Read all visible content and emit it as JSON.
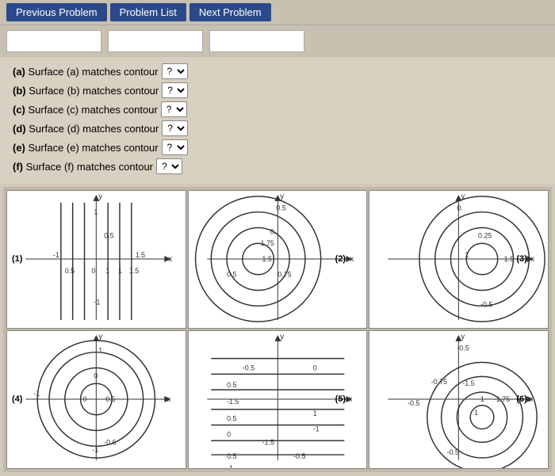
{
  "nav": {
    "prev_label": "Previous Problem",
    "list_label": "Problem List",
    "next_label": "Next Problem"
  },
  "questions": [
    {
      "label": "(a) Surface (a) matches contour",
      "id": "a"
    },
    {
      "label": "(b) Surface (b) matches contour",
      "id": "b"
    },
    {
      "label": "(c) Surface (c) matches contour",
      "id": "c"
    },
    {
      "label": "(d) Surface (d) matches contour",
      "id": "d"
    },
    {
      "label": "(e) Surface (e) matches contour",
      "id": "e"
    },
    {
      "label": "(f) Surface (f) matches contour",
      "id": "f"
    }
  ],
  "graphs": [
    {
      "id": "1",
      "label": "(1)"
    },
    {
      "id": "2",
      "label": "(2)"
    },
    {
      "id": "3",
      "label": "(3)"
    },
    {
      "id": "4",
      "label": "(4)"
    },
    {
      "id": "5",
      "label": "(5)"
    },
    {
      "id": "6",
      "label": "(6)"
    }
  ]
}
